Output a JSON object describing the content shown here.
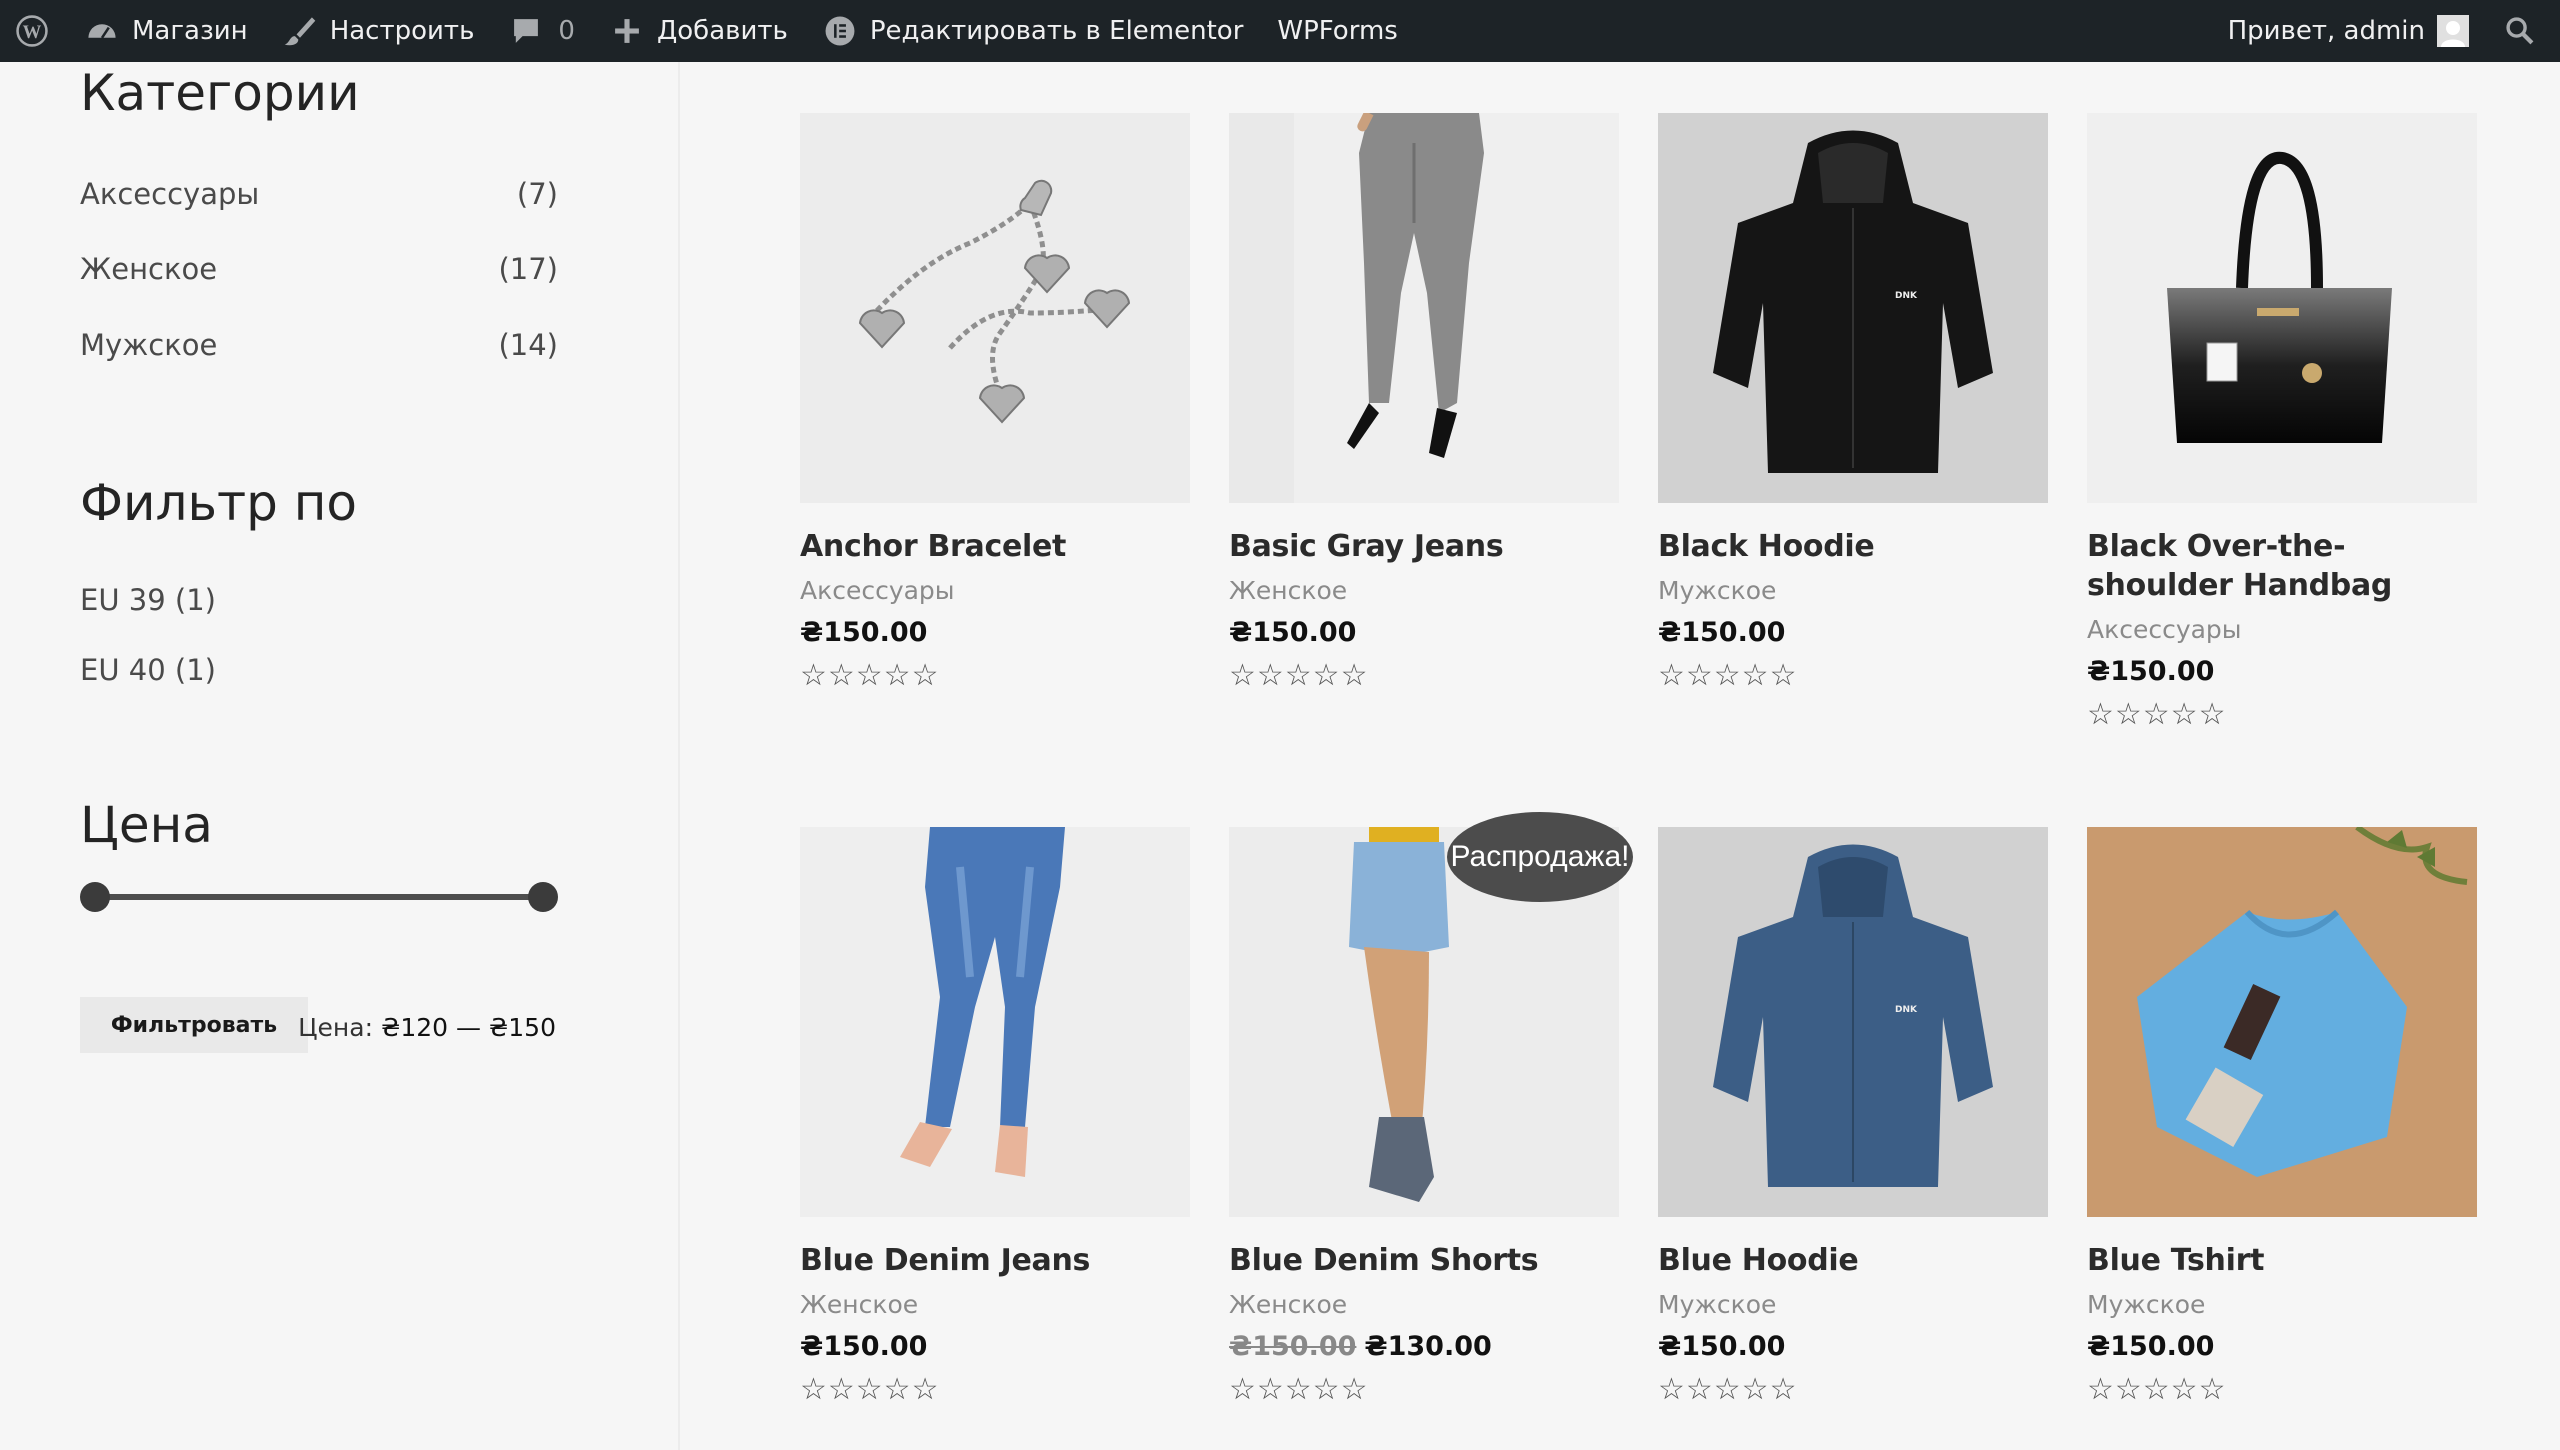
{
  "adminbar": {
    "shop": "Магазин",
    "customize": "Настроить",
    "comments_count": "0",
    "add_new": "Добавить",
    "elementor": "Редактировать в Elementor",
    "wpforms": "WPForms",
    "greeting": "Привет, admin"
  },
  "sidebar": {
    "categories_title": "Категории",
    "categories": [
      {
        "label": "Аксессуары",
        "count": "(7)"
      },
      {
        "label": "Женское",
        "count": "(17)"
      },
      {
        "label": "Мужское",
        "count": "(14)"
      }
    ],
    "filter_title": "Фильтр по",
    "filters": [
      "EU 39 (1)",
      "EU 40 (1)"
    ],
    "price_title": "Цена",
    "price_slider": {
      "min": 120,
      "max": 150
    },
    "filter_button": "Фильтровать",
    "price_prefix": "Цена:",
    "price_range": "₴120 — ₴150"
  },
  "products": [
    {
      "title": "Anchor Bracelet",
      "category": "Аксессуары",
      "price": "₴150.00",
      "old_price": "",
      "stars": "☆☆☆☆☆"
    },
    {
      "title": "Basic Gray Jeans",
      "category": "Женское",
      "price": "₴150.00",
      "old_price": "",
      "stars": "☆☆☆☆☆"
    },
    {
      "title": "Black Hoodie",
      "category": "Мужское",
      "price": "₴150.00",
      "old_price": "",
      "stars": "☆☆☆☆☆"
    },
    {
      "title": "Black Over-the-shoulder Handbag",
      "category": "Аксессуары",
      "price": "₴150.00",
      "old_price": "",
      "stars": "☆☆☆☆☆"
    },
    {
      "title": "Blue Denim Jeans",
      "category": "Женское",
      "price": "₴150.00",
      "old_price": "",
      "stars": "☆☆☆☆☆"
    },
    {
      "title": "Blue Denim Shorts",
      "category": "Женское",
      "price": "₴130.00",
      "old_price": "₴150.00",
      "stars": "☆☆☆☆☆"
    },
    {
      "title": "Blue Hoodie",
      "category": "Мужское",
      "price": "₴150.00",
      "old_price": "",
      "stars": "☆☆☆☆☆"
    },
    {
      "title": "Blue Tshirt",
      "category": "Мужское",
      "price": "₴150.00",
      "old_price": "",
      "stars": "☆☆☆☆☆"
    }
  ],
  "sale_badge": "Распродажа!",
  "hoodie_logo": "DNK",
  "colors": {
    "adminbar": "#1d2327",
    "badge": "#4c4c4c"
  }
}
